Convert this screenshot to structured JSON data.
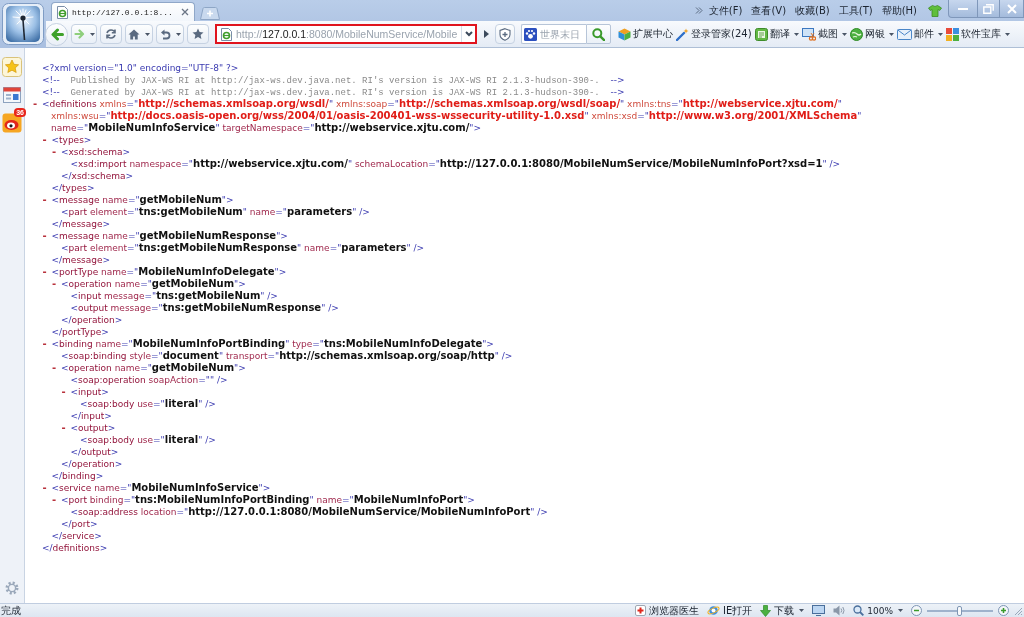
{
  "title_bar": {
    "tab": {
      "title": "http://127.0.0.1:8...",
      "selected": true
    },
    "menu": [
      "文件(F)",
      "查看(V)",
      "收藏(B)",
      "工具(T)",
      "帮助(H)"
    ]
  },
  "nav_bar": {
    "address": {
      "scheme": "http://",
      "host": "127.0.0.1",
      "path": ":8080/MobileNumService/Mobile",
      "highlighted": true
    },
    "search": {
      "placeholder": "世界末日"
    },
    "tools": [
      {
        "kind": "extensions",
        "label": "扩展中心",
        "dropdown": false
      },
      {
        "kind": "passwords",
        "label": "登录管家(24)",
        "dropdown": false
      },
      {
        "kind": "translate",
        "label": "翻译",
        "dropdown": true
      },
      {
        "kind": "screenshot",
        "label": "截图",
        "dropdown": true
      },
      {
        "kind": "banking",
        "label": "网银",
        "dropdown": true
      },
      {
        "kind": "mail",
        "label": "邮件",
        "dropdown": true
      },
      {
        "kind": "apps",
        "label": "软件宝库",
        "dropdown": true
      }
    ]
  },
  "sidebar": {
    "items": [
      {
        "kind": "favorites"
      },
      {
        "kind": "news"
      },
      {
        "kind": "weibo",
        "badge": "36"
      }
    ]
  },
  "xml": {
    "declaration": "<?xml version=\"1.0\" encoding=\"UTF-8\" ?>",
    "comments": [
      [
        {
          "kind": "mark",
          "text": "<!--"
        },
        {
          "kind": "comment",
          "text": "  Published by JAX-WS RI at http://jax-ws.dev.java.net. RI's version is JAX-WS RI 2.1.3-hudson-390-.  "
        },
        {
          "kind": "mark",
          "text": "-->"
        }
      ],
      [
        {
          "kind": "mark",
          "text": "<!--"
        },
        {
          "kind": "comment",
          "text": "  Generated by JAX-WS RI at http://jax-ws.dev.java.net. RI's version is JAX-WS RI 2.1.3-hudson-390-.  "
        },
        {
          "kind": "mark",
          "text": "-->"
        }
      ]
    ],
    "root": {
      "kind": "parent",
      "toggle": "-",
      "expanded": true,
      "open": [
        [
          {
            "kind": "mark",
            "text": "<"
          },
          {
            "kind": "tag",
            "text": "definitions"
          },
          {
            "kind": "nsattr",
            "text": " xmlns"
          },
          {
            "kind": "mark",
            "text": "=\""
          },
          {
            "kind": "nsvalue",
            "text": "http://schemas.xmlsoap.org/wsdl/"
          },
          {
            "kind": "mark",
            "text": "\""
          },
          {
            "kind": "nsattr",
            "text": " xmlns:soap"
          },
          {
            "kind": "mark",
            "text": "=\""
          },
          {
            "kind": "nsvalue",
            "text": "http://schemas.xmlsoap.org/wsdl/soap/"
          },
          {
            "kind": "mark",
            "text": "\""
          },
          {
            "kind": "nsattr",
            "text": " xmlns:tns"
          },
          {
            "kind": "mark",
            "text": "=\""
          },
          {
            "kind": "nsvalue",
            "text": "http://webservice.xjtu.com/"
          },
          {
            "kind": "mark",
            "text": "\""
          }
        ],
        [
          {
            "kind": "nsattr",
            "text": "xmlns:wsu"
          },
          {
            "kind": "mark",
            "text": "=\""
          },
          {
            "kind": "nsvalue",
            "text": "http://docs.oasis-open.org/wss/2004/01/oasis-200401-wss-wssecurity-utility-1.0.xsd"
          },
          {
            "kind": "mark",
            "text": "\""
          },
          {
            "kind": "nsattr",
            "text": " xmlns:xsd"
          },
          {
            "kind": "mark",
            "text": "=\""
          },
          {
            "kind": "nsvalue",
            "text": "http://www.w3.org/2001/XMLSchema"
          },
          {
            "kind": "mark",
            "text": "\""
          }
        ],
        [
          {
            "kind": "attr",
            "text": "name"
          },
          {
            "kind": "mark",
            "text": "=\""
          },
          {
            "kind": "value",
            "text": "MobileNumInfoService"
          },
          {
            "kind": "mark",
            "text": "\""
          },
          {
            "kind": "attr",
            "text": " targetNamespace"
          },
          {
            "kind": "mark",
            "text": "=\""
          },
          {
            "kind": "value",
            "text": "http://webservice.xjtu.com/"
          },
          {
            "kind": "mark",
            "text": "\">"
          }
        ]
      ],
      "children": [
        {
          "kind": "parent",
          "toggle": "-",
          "expanded": true,
          "open": [
            [
              {
                "kind": "mark",
                "text": "<"
              },
              {
                "kind": "tag",
                "text": "types"
              },
              {
                "kind": "mark",
                "text": ">"
              }
            ]
          ],
          "children": [
            {
              "kind": "parent",
              "toggle": "-",
              "expanded": true,
              "open": [
                [
                  {
                    "kind": "mark",
                    "text": "<"
                  },
                  {
                    "kind": "tag",
                    "text": "xsd:schema"
                  },
                  {
                    "kind": "mark",
                    "text": ">"
                  }
                ]
              ],
              "children": [
                {
                  "kind": "leaf",
                  "open": [
                    [
                      {
                        "kind": "mark",
                        "text": "<"
                      },
                      {
                        "kind": "tag",
                        "text": "xsd:import"
                      },
                      {
                        "kind": "attr",
                        "text": " namespace"
                      },
                      {
                        "kind": "mark",
                        "text": "=\""
                      },
                      {
                        "kind": "value",
                        "text": "http://webservice.xjtu.com/"
                      },
                      {
                        "kind": "mark",
                        "text": "\""
                      },
                      {
                        "kind": "attr",
                        "text": " schemaLocation"
                      },
                      {
                        "kind": "mark",
                        "text": "=\""
                      },
                      {
                        "kind": "value",
                        "text": "http://127.0.0.1:8080/MobileNumService/MobileNumInfoPort?xsd=1"
                      },
                      {
                        "kind": "mark",
                        "text": "\" />"
                      }
                    ]
                  ]
                }
              ],
              "close": [
                {
                  "kind": "mark",
                  "text": "</"
                },
                {
                  "kind": "tag",
                  "text": "xsd:schema"
                },
                {
                  "kind": "mark",
                  "text": ">"
                }
              ]
            }
          ],
          "close": [
            {
              "kind": "mark",
              "text": "</"
            },
            {
              "kind": "tag",
              "text": "types"
            },
            {
              "kind": "mark",
              "text": ">"
            }
          ]
        },
        {
          "kind": "parent",
          "toggle": "-",
          "expanded": true,
          "open": [
            [
              {
                "kind": "mark",
                "text": "<"
              },
              {
                "kind": "tag",
                "text": "message"
              },
              {
                "kind": "attr",
                "text": " name"
              },
              {
                "kind": "mark",
                "text": "=\""
              },
              {
                "kind": "value",
                "text": "getMobileNum"
              },
              {
                "kind": "mark",
                "text": "\">"
              }
            ]
          ],
          "children": [
            {
              "kind": "leaf",
              "open": [
                [
                  {
                    "kind": "mark",
                    "text": "<"
                  },
                  {
                    "kind": "tag",
                    "text": "part"
                  },
                  {
                    "kind": "attr",
                    "text": " element"
                  },
                  {
                    "kind": "mark",
                    "text": "=\""
                  },
                  {
                    "kind": "value",
                    "text": "tns:getMobileNum"
                  },
                  {
                    "kind": "mark",
                    "text": "\""
                  },
                  {
                    "kind": "attr",
                    "text": " name"
                  },
                  {
                    "kind": "mark",
                    "text": "=\""
                  },
                  {
                    "kind": "value",
                    "text": "parameters"
                  },
                  {
                    "kind": "mark",
                    "text": "\" />"
                  }
                ]
              ]
            }
          ],
          "close": [
            {
              "kind": "mark",
              "text": "</"
            },
            {
              "kind": "tag",
              "text": "message"
            },
            {
              "kind": "mark",
              "text": ">"
            }
          ]
        },
        {
          "kind": "parent",
          "toggle": "-",
          "expanded": true,
          "open": [
            [
              {
                "kind": "mark",
                "text": "<"
              },
              {
                "kind": "tag",
                "text": "message"
              },
              {
                "kind": "attr",
                "text": " name"
              },
              {
                "kind": "mark",
                "text": "=\""
              },
              {
                "kind": "value",
                "text": "getMobileNumResponse"
              },
              {
                "kind": "mark",
                "text": "\">"
              }
            ]
          ],
          "children": [
            {
              "kind": "leaf",
              "open": [
                [
                  {
                    "kind": "mark",
                    "text": "<"
                  },
                  {
                    "kind": "tag",
                    "text": "part"
                  },
                  {
                    "kind": "attr",
                    "text": " element"
                  },
                  {
                    "kind": "mark",
                    "text": "=\""
                  },
                  {
                    "kind": "value",
                    "text": "tns:getMobileNumResponse"
                  },
                  {
                    "kind": "mark",
                    "text": "\""
                  },
                  {
                    "kind": "attr",
                    "text": " name"
                  },
                  {
                    "kind": "mark",
                    "text": "=\""
                  },
                  {
                    "kind": "value",
                    "text": "parameters"
                  },
                  {
                    "kind": "mark",
                    "text": "\" />"
                  }
                ]
              ]
            }
          ],
          "close": [
            {
              "kind": "mark",
              "text": "</"
            },
            {
              "kind": "tag",
              "text": "message"
            },
            {
              "kind": "mark",
              "text": ">"
            }
          ]
        },
        {
          "kind": "parent",
          "toggle": "-",
          "expanded": true,
          "open": [
            [
              {
                "kind": "mark",
                "text": "<"
              },
              {
                "kind": "tag",
                "text": "portType"
              },
              {
                "kind": "attr",
                "text": " name"
              },
              {
                "kind": "mark",
                "text": "=\""
              },
              {
                "kind": "value",
                "text": "MobileNumInfoDelegate"
              },
              {
                "kind": "mark",
                "text": "\">"
              }
            ]
          ],
          "children": [
            {
              "kind": "parent",
              "toggle": "-",
              "expanded": true,
              "open": [
                [
                  {
                    "kind": "mark",
                    "text": "<"
                  },
                  {
                    "kind": "tag",
                    "text": "operation"
                  },
                  {
                    "kind": "attr",
                    "text": " name"
                  },
                  {
                    "kind": "mark",
                    "text": "=\""
                  },
                  {
                    "kind": "value",
                    "text": "getMobileNum"
                  },
                  {
                    "kind": "mark",
                    "text": "\">"
                  }
                ]
              ],
              "children": [
                {
                  "kind": "leaf",
                  "open": [
                    [
                      {
                        "kind": "mark",
                        "text": "<"
                      },
                      {
                        "kind": "tag",
                        "text": "input"
                      },
                      {
                        "kind": "attr",
                        "text": " message"
                      },
                      {
                        "kind": "mark",
                        "text": "=\""
                      },
                      {
                        "kind": "value",
                        "text": "tns:getMobileNum"
                      },
                      {
                        "kind": "mark",
                        "text": "\" />"
                      }
                    ]
                  ]
                },
                {
                  "kind": "leaf",
                  "open": [
                    [
                      {
                        "kind": "mark",
                        "text": "<"
                      },
                      {
                        "kind": "tag",
                        "text": "output"
                      },
                      {
                        "kind": "attr",
                        "text": " message"
                      },
                      {
                        "kind": "mark",
                        "text": "=\""
                      },
                      {
                        "kind": "value",
                        "text": "tns:getMobileNumResponse"
                      },
                      {
                        "kind": "mark",
                        "text": "\" />"
                      }
                    ]
                  ]
                }
              ],
              "close": [
                {
                  "kind": "mark",
                  "text": "</"
                },
                {
                  "kind": "tag",
                  "text": "operation"
                },
                {
                  "kind": "mark",
                  "text": ">"
                }
              ]
            }
          ],
          "close": [
            {
              "kind": "mark",
              "text": "</"
            },
            {
              "kind": "tag",
              "text": "portType"
            },
            {
              "kind": "mark",
              "text": ">"
            }
          ]
        },
        {
          "kind": "parent",
          "toggle": "-",
          "expanded": true,
          "open": [
            [
              {
                "kind": "mark",
                "text": "<"
              },
              {
                "kind": "tag",
                "text": "binding"
              },
              {
                "kind": "attr",
                "text": " name"
              },
              {
                "kind": "mark",
                "text": "=\""
              },
              {
                "kind": "value",
                "text": "MobileNumInfoPortBinding"
              },
              {
                "kind": "mark",
                "text": "\""
              },
              {
                "kind": "attr",
                "text": " type"
              },
              {
                "kind": "mark",
                "text": "=\""
              },
              {
                "kind": "value",
                "text": "tns:MobileNumInfoDelegate"
              },
              {
                "kind": "mark",
                "text": "\">"
              }
            ]
          ],
          "children": [
            {
              "kind": "leaf",
              "open": [
                [
                  {
                    "kind": "mark",
                    "text": "<"
                  },
                  {
                    "kind": "tag",
                    "text": "soap:binding"
                  },
                  {
                    "kind": "attr",
                    "text": " style"
                  },
                  {
                    "kind": "mark",
                    "text": "=\""
                  },
                  {
                    "kind": "value",
                    "text": "document"
                  },
                  {
                    "kind": "mark",
                    "text": "\""
                  },
                  {
                    "kind": "attr",
                    "text": " transport"
                  },
                  {
                    "kind": "mark",
                    "text": "=\""
                  },
                  {
                    "kind": "value",
                    "text": "http://schemas.xmlsoap.org/soap/http"
                  },
                  {
                    "kind": "mark",
                    "text": "\" />"
                  }
                ]
              ]
            },
            {
              "kind": "parent",
              "toggle": "-",
              "expanded": true,
              "open": [
                [
                  {
                    "kind": "mark",
                    "text": "<"
                  },
                  {
                    "kind": "tag",
                    "text": "operation"
                  },
                  {
                    "kind": "attr",
                    "text": " name"
                  },
                  {
                    "kind": "mark",
                    "text": "=\""
                  },
                  {
                    "kind": "value",
                    "text": "getMobileNum"
                  },
                  {
                    "kind": "mark",
                    "text": "\">"
                  }
                ]
              ],
              "children": [
                {
                  "kind": "leaf",
                  "open": [
                    [
                      {
                        "kind": "mark",
                        "text": "<"
                      },
                      {
                        "kind": "tag",
                        "text": "soap:operation"
                      },
                      {
                        "kind": "attr",
                        "text": " soapAction"
                      },
                      {
                        "kind": "mark",
                        "text": "=\"\" />"
                      }
                    ]
                  ]
                },
                {
                  "kind": "parent",
                  "toggle": "-",
                  "expanded": true,
                  "open": [
                    [
                      {
                        "kind": "mark",
                        "text": "<"
                      },
                      {
                        "kind": "tag",
                        "text": "input"
                      },
                      {
                        "kind": "mark",
                        "text": ">"
                      }
                    ]
                  ],
                  "children": [
                    {
                      "kind": "leaf",
                      "open": [
                        [
                          {
                            "kind": "mark",
                            "text": "<"
                          },
                          {
                            "kind": "tag",
                            "text": "soap:body"
                          },
                          {
                            "kind": "attr",
                            "text": " use"
                          },
                          {
                            "kind": "mark",
                            "text": "=\""
                          },
                          {
                            "kind": "value",
                            "text": "literal"
                          },
                          {
                            "kind": "mark",
                            "text": "\" />"
                          }
                        ]
                      ]
                    }
                  ],
                  "close": [
                    {
                      "kind": "mark",
                      "text": "</"
                    },
                    {
                      "kind": "tag",
                      "text": "input"
                    },
                    {
                      "kind": "mark",
                      "text": ">"
                    }
                  ]
                },
                {
                  "kind": "parent",
                  "toggle": "-",
                  "expanded": true,
                  "open": [
                    [
                      {
                        "kind": "mark",
                        "text": "<"
                      },
                      {
                        "kind": "tag",
                        "text": "output"
                      },
                      {
                        "kind": "mark",
                        "text": ">"
                      }
                    ]
                  ],
                  "children": [
                    {
                      "kind": "leaf",
                      "open": [
                        [
                          {
                            "kind": "mark",
                            "text": "<"
                          },
                          {
                            "kind": "tag",
                            "text": "soap:body"
                          },
                          {
                            "kind": "attr",
                            "text": " use"
                          },
                          {
                            "kind": "mark",
                            "text": "=\""
                          },
                          {
                            "kind": "value",
                            "text": "literal"
                          },
                          {
                            "kind": "mark",
                            "text": "\" />"
                          }
                        ]
                      ]
                    }
                  ],
                  "close": [
                    {
                      "kind": "mark",
                      "text": "</"
                    },
                    {
                      "kind": "tag",
                      "text": "output"
                    },
                    {
                      "kind": "mark",
                      "text": ">"
                    }
                  ]
                }
              ],
              "close": [
                {
                  "kind": "mark",
                  "text": "</"
                },
                {
                  "kind": "tag",
                  "text": "operation"
                },
                {
                  "kind": "mark",
                  "text": ">"
                }
              ]
            }
          ],
          "close": [
            {
              "kind": "mark",
              "text": "</"
            },
            {
              "kind": "tag",
              "text": "binding"
            },
            {
              "kind": "mark",
              "text": ">"
            }
          ]
        },
        {
          "kind": "parent",
          "toggle": "-",
          "expanded": true,
          "open": [
            [
              {
                "kind": "mark",
                "text": "<"
              },
              {
                "kind": "tag",
                "text": "service"
              },
              {
                "kind": "attr",
                "text": " name"
              },
              {
                "kind": "mark",
                "text": "=\""
              },
              {
                "kind": "value",
                "text": "MobileNumInfoService"
              },
              {
                "kind": "mark",
                "text": "\">"
              }
            ]
          ],
          "children": [
            {
              "kind": "parent",
              "toggle": "-",
              "expanded": true,
              "open": [
                [
                  {
                    "kind": "mark",
                    "text": "<"
                  },
                  {
                    "kind": "tag",
                    "text": "port"
                  },
                  {
                    "kind": "attr",
                    "text": " binding"
                  },
                  {
                    "kind": "mark",
                    "text": "=\""
                  },
                  {
                    "kind": "value",
                    "text": "tns:MobileNumInfoPortBinding"
                  },
                  {
                    "kind": "mark",
                    "text": "\""
                  },
                  {
                    "kind": "attr",
                    "text": " name"
                  },
                  {
                    "kind": "mark",
                    "text": "=\""
                  },
                  {
                    "kind": "value",
                    "text": "MobileNumInfoPort"
                  },
                  {
                    "kind": "mark",
                    "text": "\">"
                  }
                ]
              ],
              "children": [
                {
                  "kind": "leaf",
                  "open": [
                    [
                      {
                        "kind": "mark",
                        "text": "<"
                      },
                      {
                        "kind": "tag",
                        "text": "soap:address"
                      },
                      {
                        "kind": "attr",
                        "text": " location"
                      },
                      {
                        "kind": "mark",
                        "text": "=\""
                      },
                      {
                        "kind": "value",
                        "text": "http://127.0.0.1:8080/MobileNumService/MobileNumInfoPort"
                      },
                      {
                        "kind": "mark",
                        "text": "\" />"
                      }
                    ]
                  ]
                }
              ],
              "close": [
                {
                  "kind": "mark",
                  "text": "</"
                },
                {
                  "kind": "tag",
                  "text": "port"
                },
                {
                  "kind": "mark",
                  "text": ">"
                }
              ]
            }
          ],
          "close": [
            {
              "kind": "mark",
              "text": "</"
            },
            {
              "kind": "tag",
              "text": "service"
            },
            {
              "kind": "mark",
              "text": ">"
            }
          ]
        }
      ],
      "close": [
        {
          "kind": "mark",
          "text": "</"
        },
        {
          "kind": "tag",
          "text": "definitions"
        },
        {
          "kind": "mark",
          "text": ">"
        }
      ]
    }
  },
  "status_bar": {
    "text": "完成",
    "items": [
      {
        "kind": "doctor",
        "label": "浏览器医生",
        "dropdown": false
      },
      {
        "kind": "ie",
        "label": "IE打开",
        "dropdown": false
      },
      {
        "kind": "download",
        "label": "下载",
        "dropdown": true
      }
    ],
    "zoom": {
      "label": "100%",
      "level": 0.5
    }
  }
}
